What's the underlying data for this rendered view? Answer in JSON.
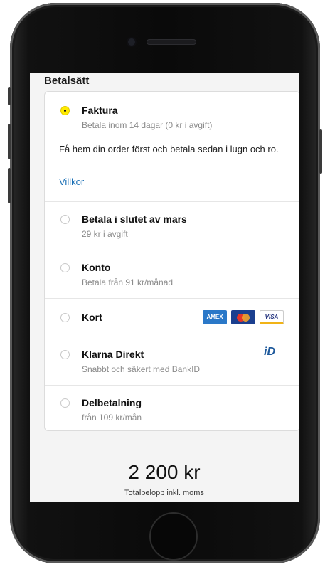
{
  "section_title": "Betalsätt",
  "options": [
    {
      "title": "Faktura",
      "subtitle": "Betala inom 14 dagar (0 kr i avgift)",
      "selected": true,
      "description": "Få hem din order först och betala sedan i lugn och ro.",
      "link": "Villkor"
    },
    {
      "title": "Betala i slutet av mars",
      "subtitle": "29 kr i avgift",
      "selected": false
    },
    {
      "title": "Konto",
      "subtitle": "Betala från 91 kr/månad",
      "selected": false
    },
    {
      "title": "Kort",
      "subtitle": "",
      "selected": false,
      "logos": {
        "amex": "AMEX",
        "mastercard": "MasterCard",
        "visa": "VISA"
      }
    },
    {
      "title": "Klarna Direkt",
      "subtitle": "Snabbt och säkert med BankID",
      "selected": false,
      "logo": "BankID"
    },
    {
      "title": "Delbetalning",
      "subtitle": "från 109 kr/mån",
      "selected": false
    }
  ],
  "total": {
    "amount": "2 200 kr",
    "label": "Totalbelopp inkl. moms"
  },
  "colors": {
    "accent_yellow": "#ffeb00",
    "link_blue": "#1a6fb5"
  },
  "icons": [
    "radio-selected-icon",
    "radio-icon",
    "amex-icon",
    "mastercard-icon",
    "visa-icon",
    "bankid-icon"
  ]
}
